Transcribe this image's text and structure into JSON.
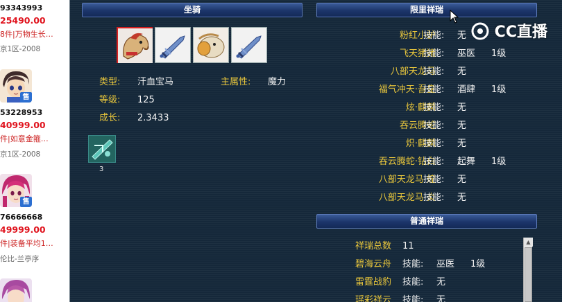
{
  "listings": [
    {
      "id": "93343993",
      "price": "25490.00",
      "tags": "8件|万物生长…",
      "server": "京1区-2008"
    },
    {
      "id": "53228953",
      "price": "40999.00",
      "tags": "件|如意金箍…",
      "server": "京1区-2008",
      "badge": "售"
    },
    {
      "id": "76666668",
      "price": "49999.00",
      "tags": "件|装备平均1…",
      "server": "伦比-兰亭序",
      "badge": "售"
    }
  ],
  "mount_panel": {
    "title": "坐骑",
    "type_label": "类型:",
    "type_value": "汗血宝马",
    "attr_label": "主属性:",
    "attr_value": "魔力",
    "level_label": "等级:",
    "level_value": "125",
    "growth_label": "成长:",
    "growth_value": "2.3433",
    "skill_count": "3"
  },
  "limited": {
    "title": "限里祥瑞",
    "items": [
      {
        "name": "粉红小驴",
        "skill_label": "技能:",
        "skill": "无",
        "level": ""
      },
      {
        "name": "飞天猪猪",
        "skill_label": "技能:",
        "skill": "巫医",
        "level": "1级"
      },
      {
        "name": "八部天龙马",
        "skill_label": "技能:",
        "skill": "无",
        "level": ""
      },
      {
        "name": "福气冲天·吾皇",
        "skill_label": "技能:",
        "skill": "酒肆",
        "level": "1级"
      },
      {
        "name": "炫·麒麟",
        "skill_label": "技能:",
        "skill": "无",
        "level": ""
      },
      {
        "name": "吞云腾蛇",
        "skill_label": "技能:",
        "skill": "无",
        "level": ""
      },
      {
        "name": "炽·麒麟",
        "skill_label": "技能:",
        "skill": "无",
        "level": ""
      },
      {
        "name": "吞云腾蛇·钻白",
        "skill_label": "技能:",
        "skill": "起舞",
        "level": "1级"
      },
      {
        "name": "八部天龙马·煌",
        "skill_label": "技能:",
        "skill": "无",
        "level": ""
      },
      {
        "name": "八部天龙马·炎",
        "skill_label": "技能:",
        "skill": "无",
        "level": ""
      }
    ]
  },
  "common": {
    "title": "普通祥瑞",
    "total_label": "祥瑞总数",
    "total_value": "11",
    "items": [
      {
        "name": "碧海云舟",
        "skill_label": "技能:",
        "skill": "巫医",
        "level": "1级"
      },
      {
        "name": "雷霆战豹",
        "skill_label": "技能:",
        "skill": "无",
        "level": ""
      },
      {
        "name": "瑶彩祥云",
        "skill_label": "技能:",
        "skill": "无",
        "level": ""
      }
    ]
  },
  "watermark": "CC直播",
  "colors": {
    "gold": "#e8c63c",
    "price_red": "#e0141e",
    "panel_bg": "#15283a",
    "header_blue": "#1c356a"
  }
}
